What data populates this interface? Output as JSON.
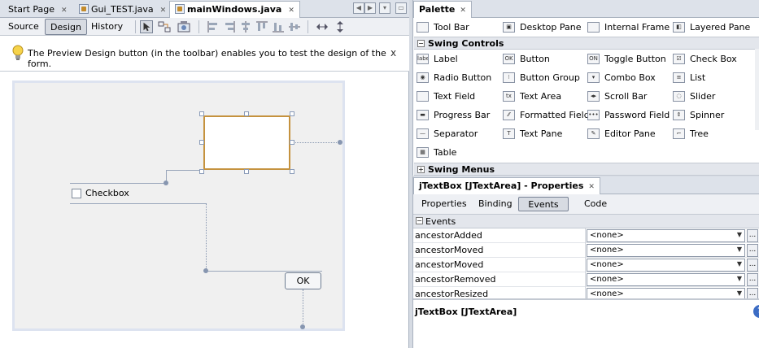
{
  "editor": {
    "tabs": [
      {
        "label": "Start Page"
      },
      {
        "label": "Gui_TEST.java"
      },
      {
        "label": "mainWindows.java"
      }
    ],
    "modes": {
      "source": "Source",
      "design": "Design",
      "history": "History"
    },
    "hint": "The Preview Design button (in the toolbar) enables you to test the design of the form.",
    "hint_close": "x",
    "form": {
      "checkbox_label": "Checkbox",
      "ok_label": "OK"
    }
  },
  "palette": {
    "title": "Palette",
    "containers_items": [
      {
        "label": "Tool Bar",
        "icon": "toolbar-icon"
      },
      {
        "label": "Desktop Pane",
        "icon": "desktop-pane-icon"
      },
      {
        "label": "Internal Frame",
        "icon": "internal-frame-icon"
      },
      {
        "label": "Layered Pane",
        "icon": "layered-pane-icon"
      }
    ],
    "swing_controls_label": "Swing Controls",
    "controls": [
      {
        "label": "Label",
        "glyph": "label"
      },
      {
        "label": "Button",
        "glyph": "OK"
      },
      {
        "label": "Toggle Button",
        "glyph": "ON"
      },
      {
        "label": "Check Box",
        "glyph": "☑"
      },
      {
        "label": "Radio Button",
        "glyph": "◉"
      },
      {
        "label": "Button Group",
        "glyph": "⁝"
      },
      {
        "label": "Combo Box",
        "glyph": "▾"
      },
      {
        "label": "List",
        "glyph": "≡"
      },
      {
        "label": "Text Field",
        "glyph": ""
      },
      {
        "label": "Text Area",
        "glyph": "tx"
      },
      {
        "label": "Scroll Bar",
        "glyph": "◂▸"
      },
      {
        "label": "Slider",
        "glyph": "◌"
      },
      {
        "label": "Progress Bar",
        "glyph": "▬"
      },
      {
        "label": "Formatted Field",
        "glyph": "⁄⁄"
      },
      {
        "label": "Password Field",
        "glyph": "•••"
      },
      {
        "label": "Spinner",
        "glyph": "⇕"
      },
      {
        "label": "Separator",
        "glyph": "—"
      },
      {
        "label": "Text Pane",
        "glyph": "T"
      },
      {
        "label": "Editor Pane",
        "glyph": "✎"
      },
      {
        "label": "Tree",
        "glyph": "⌐"
      },
      {
        "label": "Table",
        "glyph": "▦"
      }
    ],
    "swing_menus_label": "Swing Menus"
  },
  "properties": {
    "title": "jTextBox [JTextArea] - Properties",
    "tabs": {
      "properties": "Properties",
      "binding": "Binding",
      "events": "Events",
      "code": "Code"
    },
    "events_header": "Events",
    "events": [
      {
        "name": "ancestorAdded",
        "value": "<none>"
      },
      {
        "name": "ancestorMoved",
        "value": "<none>"
      },
      {
        "name": "ancestorMoved",
        "value": "<none>"
      },
      {
        "name": "ancestorRemoved",
        "value": "<none>"
      },
      {
        "name": "ancestorResized",
        "value": "<none>"
      }
    ],
    "more_label": "...",
    "description_title": "jTextBox [JTextArea]",
    "help_label": "?"
  }
}
